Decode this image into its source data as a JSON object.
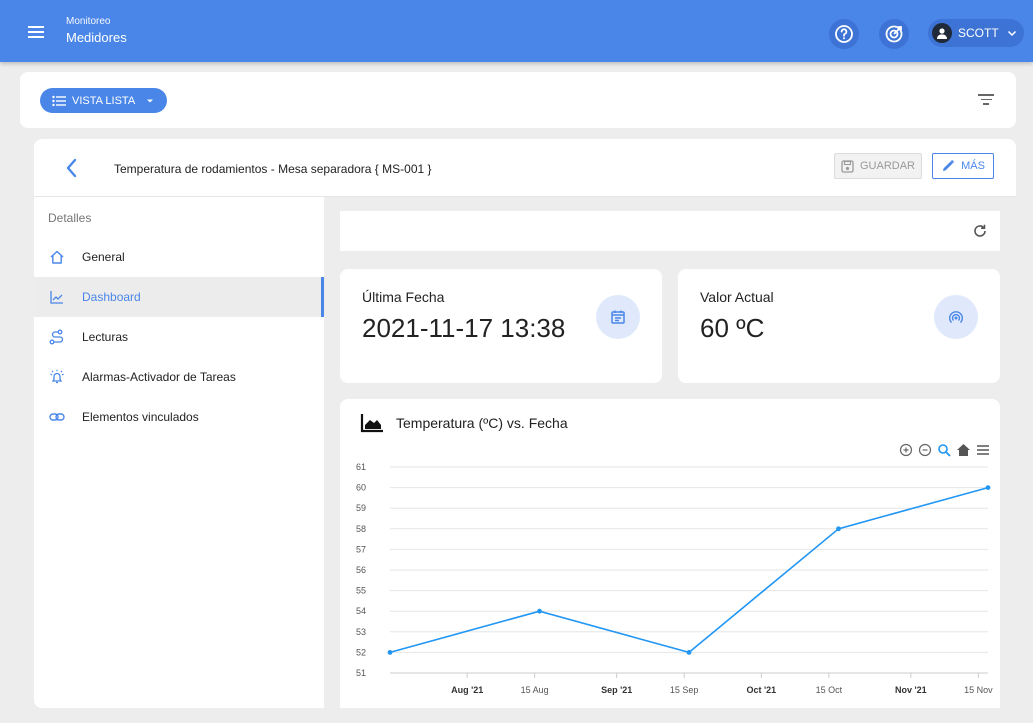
{
  "topbar": {
    "title_small": "Monitoreo",
    "title_main": "Medidores",
    "user_name": "SCOTT",
    "help_icon": "help-circle-icon",
    "target_icon": "target-icon",
    "accent": "#4a86e8"
  },
  "toolbar": {
    "view_label": "VISTA LISTA"
  },
  "header": {
    "title": "Temperatura de rodamientos - Mesa separadora { MS-001 }",
    "save_label": "GUARDAR",
    "more_label": "MÁS"
  },
  "sidebar": {
    "heading": "Detalles",
    "items": [
      {
        "label": "General",
        "icon": "home-icon"
      },
      {
        "label": "Dashboard",
        "icon": "line-chart-icon",
        "active": true
      },
      {
        "label": "Lecturas",
        "icon": "route-icon"
      },
      {
        "label": "Alarmas-Activador de Tareas",
        "icon": "alarm-icon"
      },
      {
        "label": "Elementos vinculados",
        "icon": "link-icon"
      }
    ]
  },
  "stats": {
    "last_date_label": "Última Fecha",
    "last_date_value": "2021-11-17 13:38",
    "current_value_label": "Valor Actual",
    "current_value": "60 ºC"
  },
  "chart_data": {
    "type": "line",
    "title": "Temperatura (ºC) vs. Fecha",
    "x": [
      "2021-07-16",
      "2021-08-16",
      "2021-09-16",
      "2021-10-17",
      "2021-11-17"
    ],
    "values": [
      52,
      54,
      52,
      58,
      60
    ],
    "ylim": [
      51,
      61
    ],
    "yticks": [
      51,
      52,
      53,
      54,
      55,
      56,
      57,
      58,
      59,
      60,
      61
    ],
    "xticks": [
      {
        "label": "Aug '21",
        "date": "2021-08-01",
        "bold": true
      },
      {
        "label": "15 Aug",
        "date": "2021-08-15",
        "bold": false
      },
      {
        "label": "Sep '21",
        "date": "2021-09-01",
        "bold": true
      },
      {
        "label": "15 Sep",
        "date": "2021-09-15",
        "bold": false
      },
      {
        "label": "Oct '21",
        "date": "2021-10-01",
        "bold": true
      },
      {
        "label": "15 Oct",
        "date": "2021-10-15",
        "bold": false
      },
      {
        "label": "Nov '21",
        "date": "2021-11-01",
        "bold": true
      },
      {
        "label": "15 Nov",
        "date": "2021-11-15",
        "bold": false
      }
    ],
    "grid": true,
    "color": "#2196f3"
  }
}
